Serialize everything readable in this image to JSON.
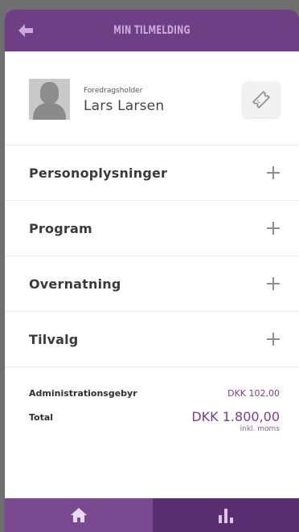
{
  "header": {
    "title": "MIN TILMELDING",
    "back_icon": "arrow-left-icon"
  },
  "profile": {
    "role": "Foredragsholder",
    "name": "Lars Larsen",
    "action_icon": "ticket-icon"
  },
  "sections": [
    {
      "label": "Personoplysninger",
      "icon": "plus-icon"
    },
    {
      "label": "Program",
      "icon": "plus-icon"
    },
    {
      "label": "Overnatning",
      "icon": "plus-icon"
    },
    {
      "label": "Tilvalg",
      "icon": "plus-icon"
    }
  ],
  "fees": {
    "admin_label": "Administrationsgebyr",
    "admin_value": "DKK 102,00",
    "total_label": "Total",
    "total_value": "DKK 1.800,00",
    "total_note": "inkl. moms"
  },
  "bottom_nav": {
    "home_icon": "home-icon",
    "stats_icon": "bar-chart-icon"
  },
  "colors": {
    "brand_purple": "#6f3f86",
    "accent_text": "#7a3d8f",
    "nav_left": "#7a4a90",
    "nav_right": "#5a2f72"
  }
}
